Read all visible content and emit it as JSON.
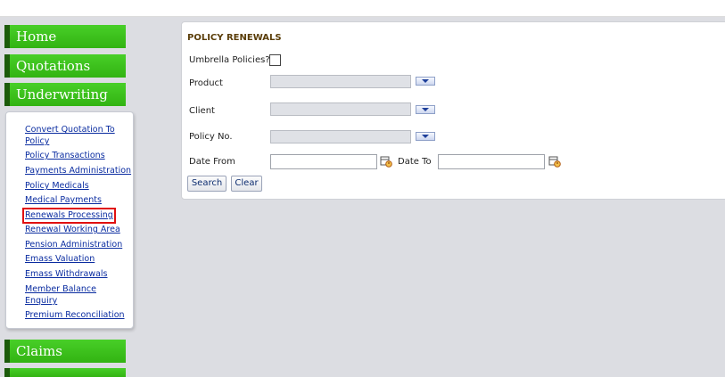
{
  "menu": {
    "home": "Home",
    "quotations": "Quotations",
    "underwriting": "Underwriting",
    "claims": "Claims"
  },
  "submenu": {
    "items": [
      {
        "label": "Convert Quotation To"
      },
      {
        "label": "Policy"
      },
      {
        "label": "Policy Transactions"
      },
      {
        "label": "Payments Administration"
      },
      {
        "label": "Policy Medicals"
      },
      {
        "label": "Medical Payments"
      },
      {
        "label": "Renewals Processing"
      },
      {
        "label": "Renewal Working Area"
      },
      {
        "label": "Pension Administration"
      },
      {
        "label": "Emass Valuation"
      },
      {
        "label": "Emass Withdrawals"
      },
      {
        "label": "Member Balance"
      },
      {
        "label": "Enquiry"
      },
      {
        "label": "Premium Reconciliation"
      }
    ]
  },
  "form": {
    "title": "POLICY RENEWALS",
    "umbrella_label": "Umbrella Policies?",
    "product_label": "Product",
    "client_label": "Client",
    "policy_no_label": "Policy No.",
    "date_from_label": "Date From",
    "date_to_label": "Date To",
    "search_label": "Search",
    "clear_label": "Clear"
  },
  "colors": {
    "menu_green": "#3fc21f",
    "highlight": "#e01010",
    "link": "#0a2ca0",
    "title": "#5a3d08"
  }
}
